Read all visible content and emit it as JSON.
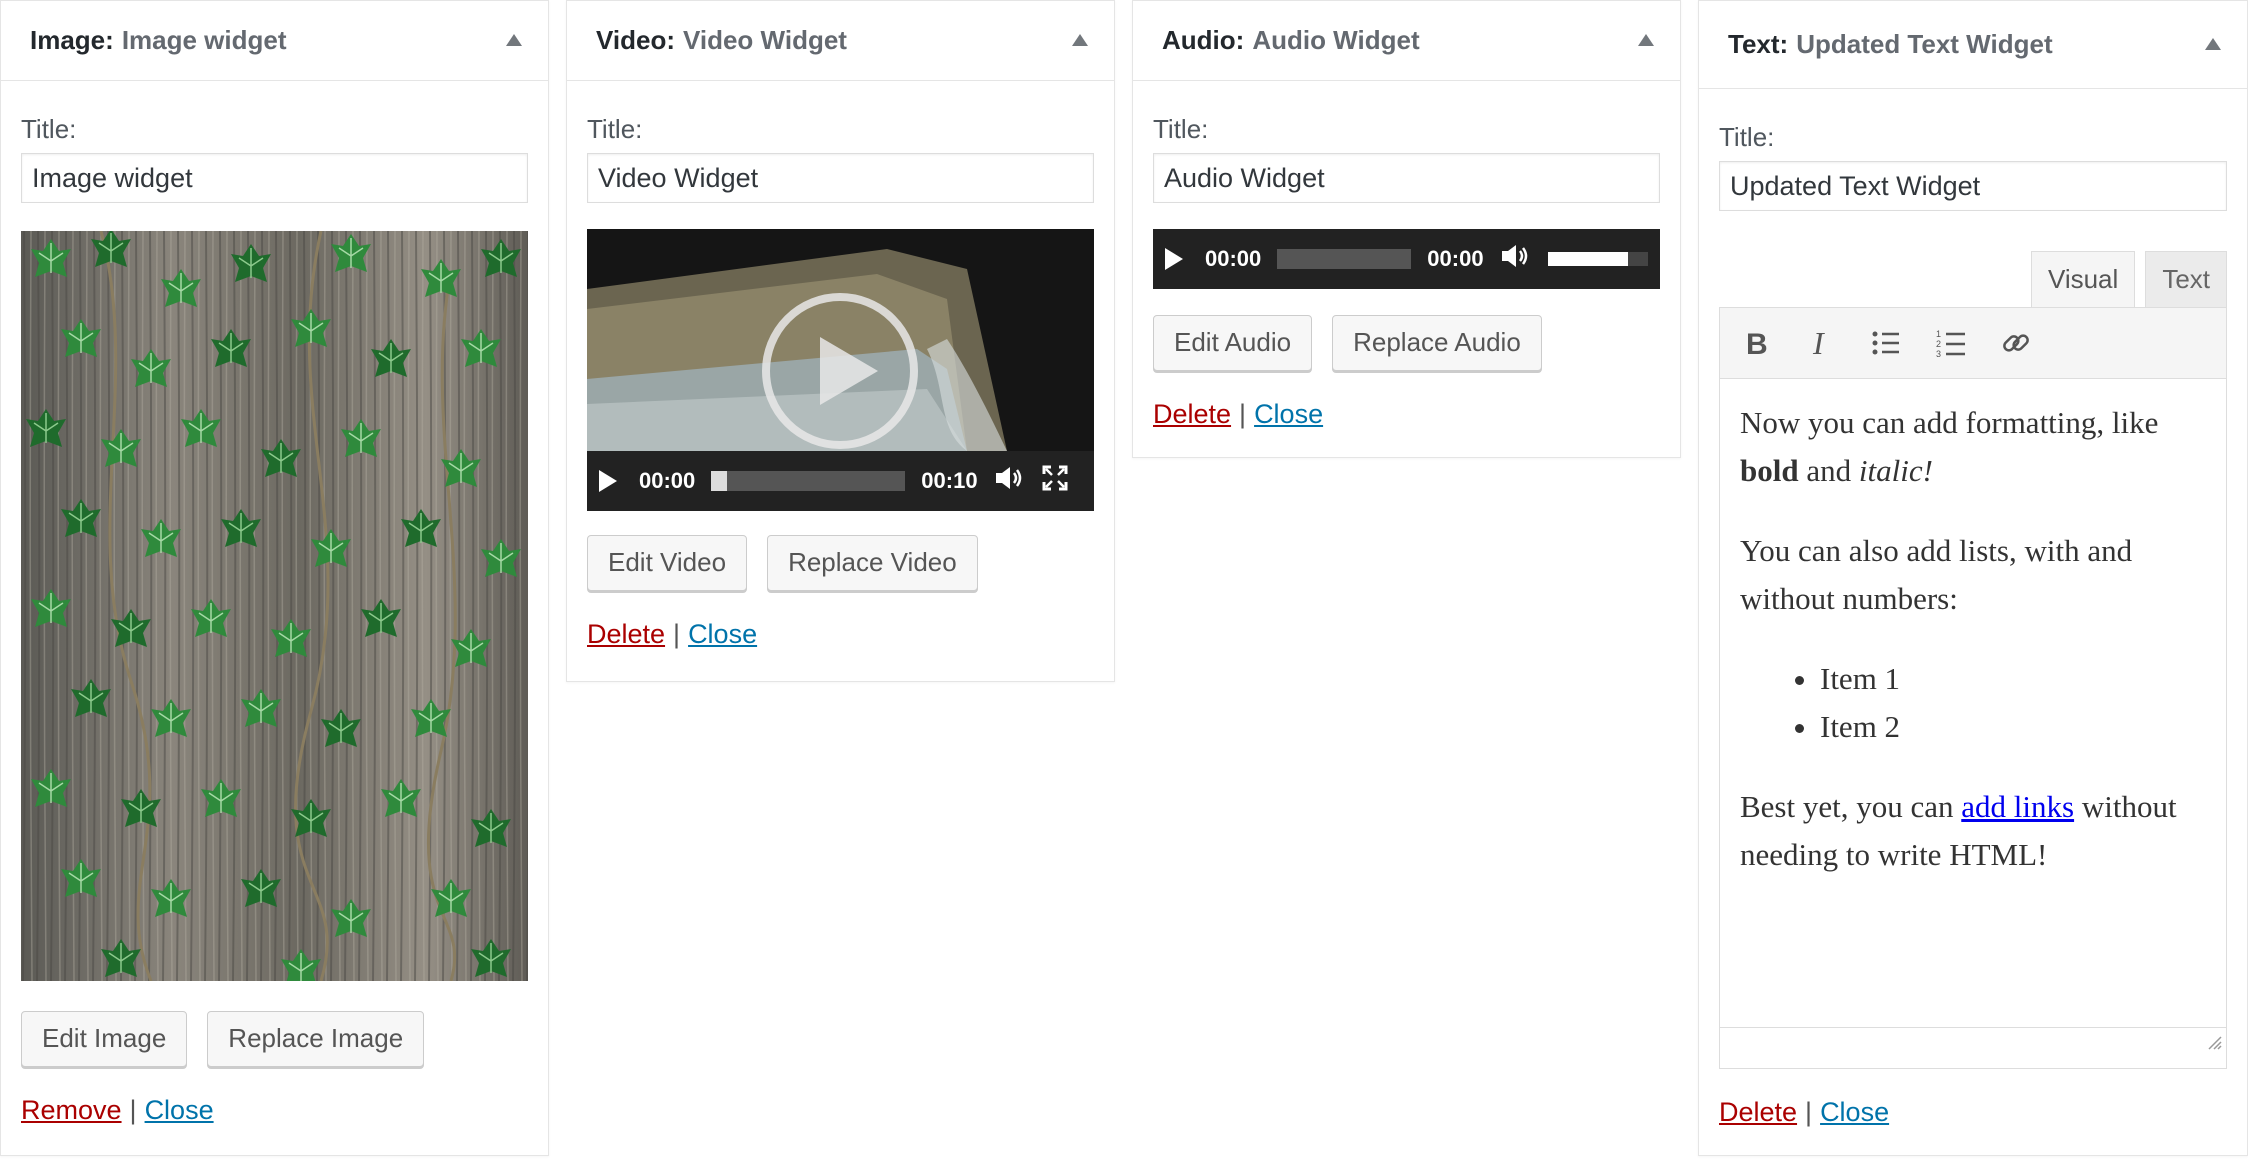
{
  "image_widget": {
    "type_label": "Image:",
    "name": "Image widget",
    "title_label": "Title:",
    "title_value": "Image widget",
    "edit_button": "Edit Image",
    "replace_button": "Replace Image",
    "remove_link": "Remove",
    "separator": "|",
    "close_link": "Close"
  },
  "video_widget": {
    "type_label": "Video:",
    "name": "Video Widget",
    "title_label": "Title:",
    "title_value": "Video Widget",
    "current_time": "00:00",
    "duration": "00:10",
    "edit_button": "Edit Video",
    "replace_button": "Replace Video",
    "delete_link": "Delete",
    "separator": "|",
    "close_link": "Close"
  },
  "audio_widget": {
    "type_label": "Audio:",
    "name": "Audio Widget",
    "title_label": "Title:",
    "title_value": "Audio Widget",
    "current_time": "00:00",
    "duration": "00:00",
    "volume": 0.8,
    "edit_button": "Edit Audio",
    "replace_button": "Replace Audio",
    "delete_link": "Delete",
    "separator": "|",
    "close_link": "Close"
  },
  "text_widget": {
    "type_label": "Text:",
    "name": "Updated Text Widget",
    "title_label": "Title:",
    "title_value": "Updated Text Widget",
    "tab_visual": "Visual",
    "tab_text": "Text",
    "toolbar_icons": [
      "bold-icon",
      "italic-icon",
      "bullet-list-icon",
      "numbered-list-icon",
      "link-icon"
    ],
    "content": {
      "p1_start": "Now you can add formatting, like ",
      "p1_bold": "bold",
      "p1_mid": " and ",
      "p1_italic": "italic!",
      "p2": "You can also add lists, with and without numbers:",
      "list": [
        "Item 1",
        "Item 2"
      ],
      "p3_start": "Best yet, you can ",
      "p3_link": "add links",
      "p3_end": " without needing to write HTML!"
    },
    "delete_link": "Delete",
    "separator": "|",
    "close_link": "Close"
  },
  "colors": {
    "delete_link": "#aa0000",
    "close_link": "#0073aa",
    "player_bg": "#222222"
  }
}
